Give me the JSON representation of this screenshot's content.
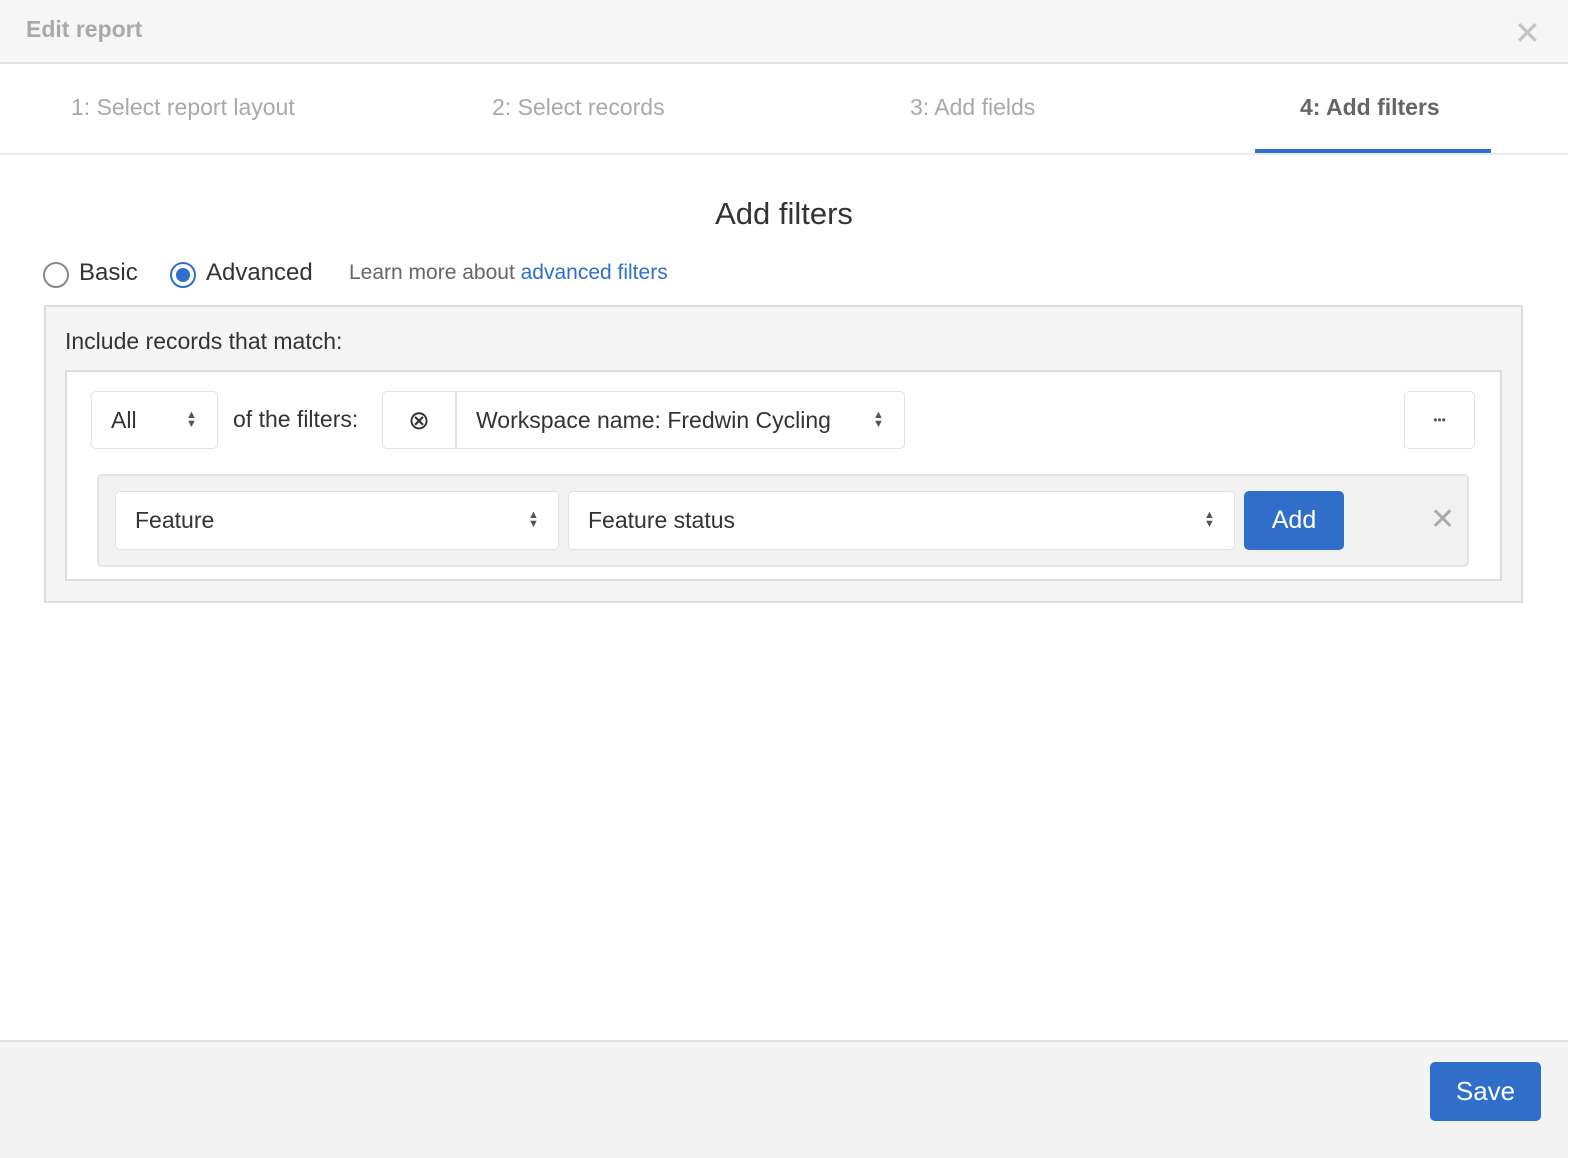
{
  "header": {
    "title": "Edit report",
    "close_icon": "close-icon"
  },
  "tabs": [
    {
      "label": "1: Select report layout"
    },
    {
      "label": "2: Select records"
    },
    {
      "label": "3: Add fields"
    },
    {
      "label": "4: Add filters",
      "active": true
    }
  ],
  "main": {
    "heading": "Add filters",
    "mode": {
      "basic": "Basic",
      "advanced": "Advanced",
      "selected": "Advanced"
    },
    "learn_prefix": "Learn more about ",
    "learn_link": "advanced filters",
    "include_label": "Include records that match:",
    "match_select": "All",
    "of_filters": "of the filters:",
    "existing_filter": "Workspace name: Fredwin Cycling",
    "more": "•••",
    "new_filter": {
      "record_type": "Feature",
      "field": "Feature status",
      "add_label": "Add"
    }
  },
  "footer": {
    "save_label": "Save"
  },
  "colors": {
    "accent": "#2f6fca"
  }
}
